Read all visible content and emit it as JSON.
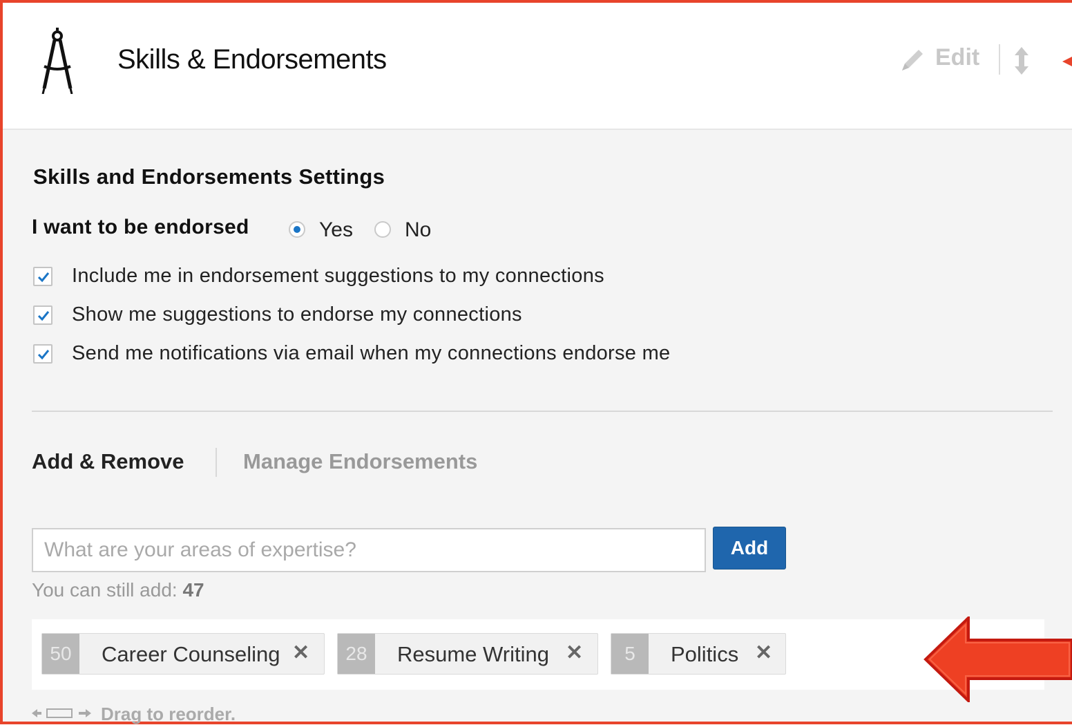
{
  "header": {
    "title": "Skills & Endorsements",
    "icon": "compass-icon",
    "edit_label": "Edit"
  },
  "settings": {
    "title": "Skills and Endorsements Settings",
    "endorse_label": "I want to be endorsed",
    "radio_options": [
      {
        "label": "Yes",
        "checked": true
      },
      {
        "label": "No",
        "checked": false
      }
    ],
    "checkboxes": [
      {
        "label": "Include me in endorsement suggestions to my connections",
        "checked": true
      },
      {
        "label": "Show me suggestions to endorse my connections",
        "checked": true
      },
      {
        "label": "Send me notifications via email when my connections endorse me",
        "checked": true
      }
    ]
  },
  "tabs": {
    "active": "Add & Remove",
    "other": "Manage Endorsements"
  },
  "add_skill": {
    "placeholder": "What are your areas of expertise?",
    "button_label": "Add",
    "can_add_text": "You can still add:",
    "can_add_count": "47"
  },
  "skills": [
    {
      "count": "50",
      "name": "Career Counseling"
    },
    {
      "count": "28",
      "name": "Resume Writing"
    },
    {
      "count": "5",
      "name": "Politics"
    }
  ],
  "drag_hint": "Drag to reorder.",
  "colors": {
    "accent_blue": "#1f66ad",
    "annotation_red": "#e8442b"
  }
}
